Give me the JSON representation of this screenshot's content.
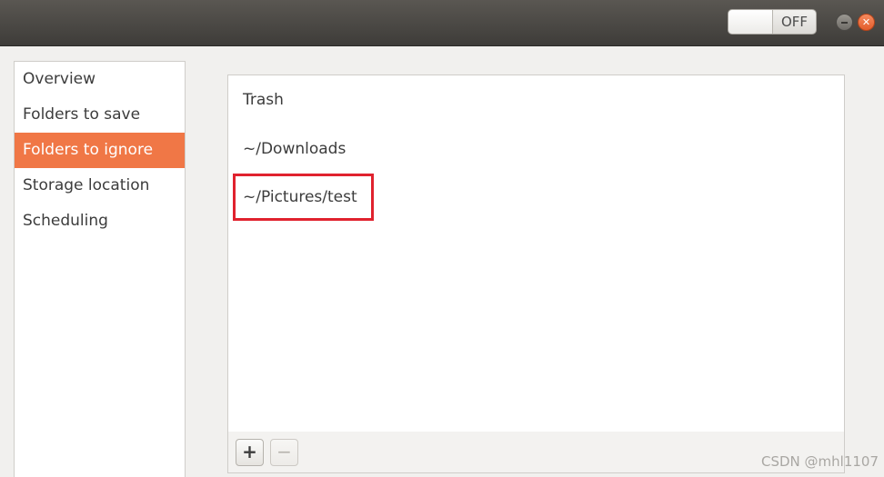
{
  "titlebar": {
    "switch_label": "OFF",
    "minimize_icon": "minimize-icon",
    "close_icon": "close-icon",
    "close_glyph": "✕"
  },
  "sidebar": {
    "items": [
      {
        "label": "Overview",
        "active": false
      },
      {
        "label": "Folders to save",
        "active": false
      },
      {
        "label": "Folders to ignore",
        "active": true
      },
      {
        "label": "Storage location",
        "active": false
      },
      {
        "label": "Scheduling",
        "active": false
      }
    ]
  },
  "ignore_list": {
    "items": [
      "Trash",
      "~/Downloads",
      "~/Pictures/test"
    ]
  },
  "toolbar": {
    "add_label": "+",
    "remove_label": "−"
  },
  "watermark": "CSDN @mhl1107",
  "colors": {
    "accent": "#f07746",
    "highlight": "#e0222e",
    "close": "#e45d2c"
  }
}
